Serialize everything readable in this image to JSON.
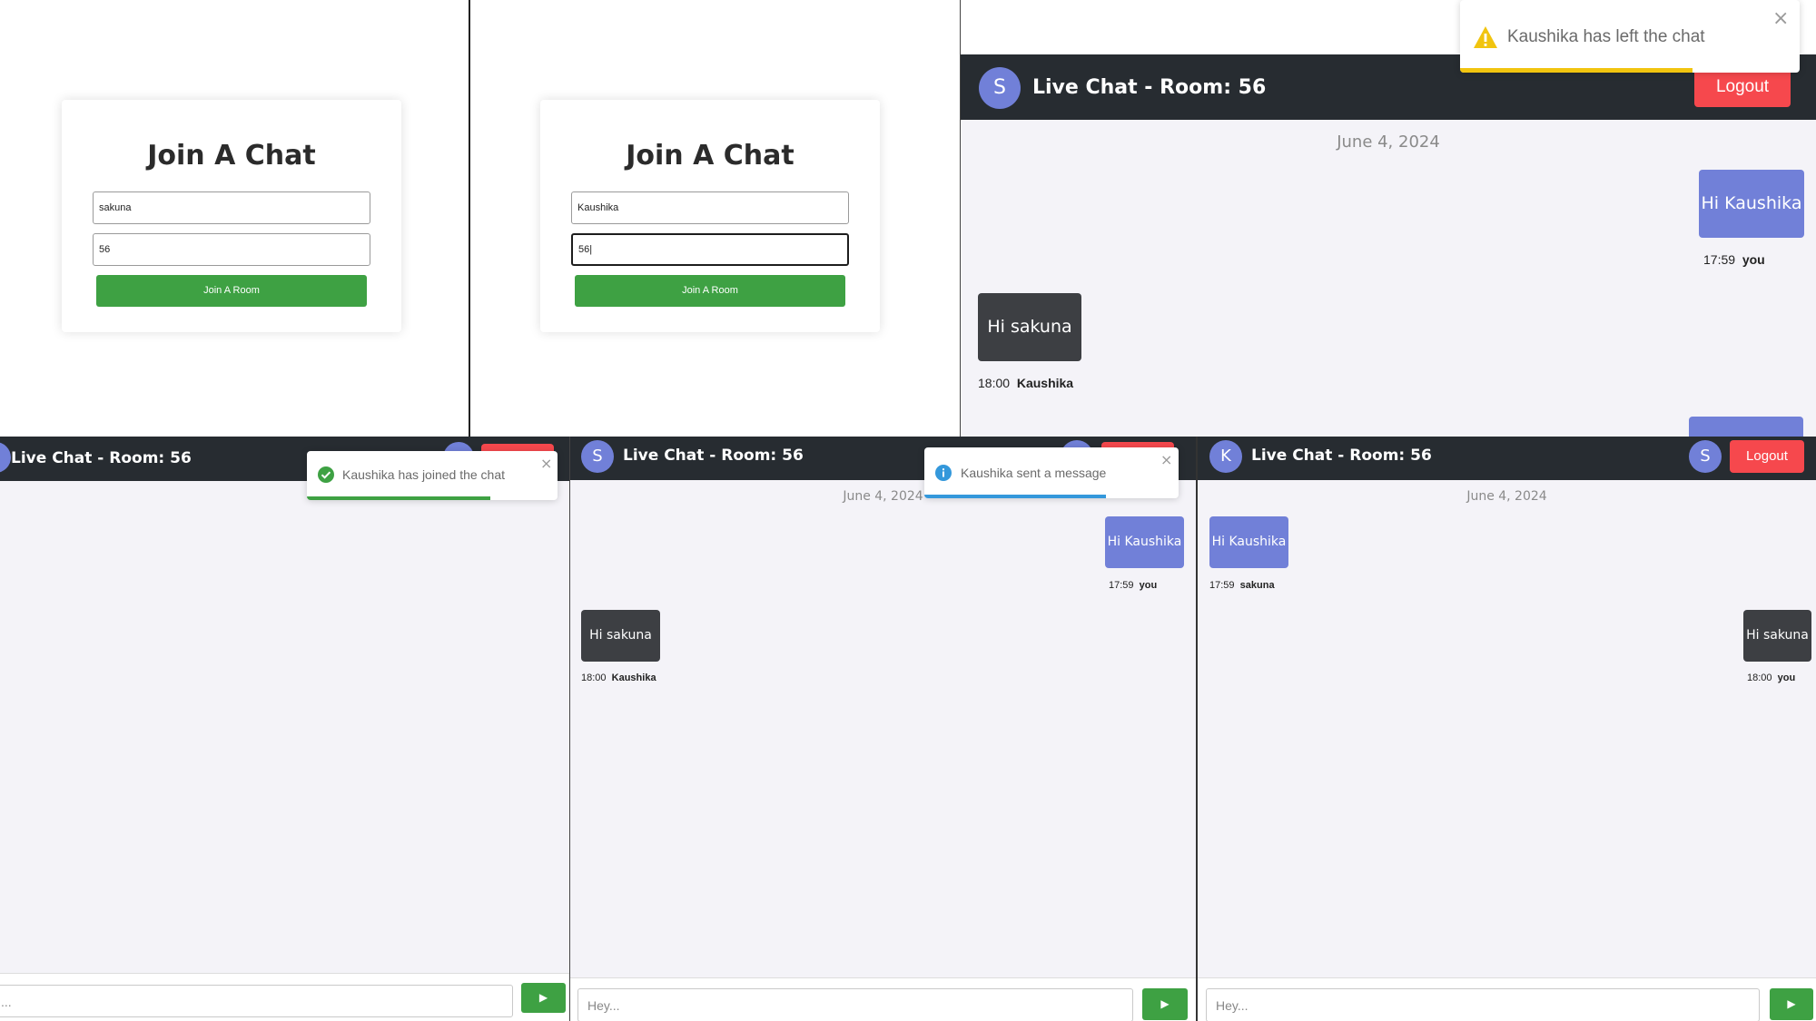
{
  "join_panel_1": {
    "title": "Join A Chat",
    "username_value": "sakuna",
    "room_value": "56",
    "button_label": "Join A Room"
  },
  "join_panel_2": {
    "title": "Join A Chat",
    "username_value": "Kaushika",
    "room_value": "56|",
    "button_label": "Join A Room"
  },
  "chat_top_right": {
    "room_title": "Live Chat - Room: 56",
    "avatar_letter": "S",
    "logout_label": "Logout",
    "date": "June 4, 2024",
    "messages": [
      {
        "text": "Hi Kaushika",
        "time": "17:59",
        "sender": "you"
      },
      {
        "text": "Hi sakuna",
        "time": "18:00",
        "sender": "Kaushika"
      }
    ],
    "toast": {
      "text": "Kaushika has left the chat",
      "type": "warning",
      "close": "×"
    }
  },
  "chat_bottom_left": {
    "room_title": "Live Chat - Room: 56",
    "toast": {
      "text": "Kaushika has joined the chat",
      "type": "success",
      "close": "×"
    },
    "input_placeholder": "...",
    "send_icon": "▶"
  },
  "chat_bottom_middle": {
    "room_title": "Live Chat - Room: 56",
    "avatar_letter": "S",
    "date": "June 4, 2024",
    "messages": [
      {
        "text": "Hi Kaushika",
        "time": "17:59",
        "sender": "you"
      },
      {
        "text": "Hi sakuna",
        "time": "18:00",
        "sender": "Kaushika"
      }
    ],
    "toast": {
      "text": "Kaushika sent a message",
      "type": "info",
      "close": "×"
    },
    "input_placeholder": "Hey...",
    "send_icon": "▶"
  },
  "chat_bottom_right": {
    "room_title": "Live Chat - Room: 56",
    "avatar_letter": "K",
    "header_avatar_letter": "S",
    "logout_label": "Logout",
    "date": "June 4, 2024",
    "messages": [
      {
        "text": "Hi Kaushika",
        "time": "17:59",
        "sender": "sakuna"
      },
      {
        "text": "Hi sakuna",
        "time": "18:00",
        "sender": "you"
      }
    ],
    "input_placeholder": "Hey...",
    "send_icon": "▶"
  },
  "colors": {
    "header_bg": "#272c31",
    "chat_bg": "#f4f3f8",
    "avatar": "#7180d8",
    "my_bubble": "#7180d8",
    "their_bubble": "#3d3f43",
    "logout": "#f6484d",
    "join_button": "#3ea143",
    "toast_warning": "#f1c40f",
    "toast_success": "#3ea143",
    "toast_info": "#3498db"
  }
}
